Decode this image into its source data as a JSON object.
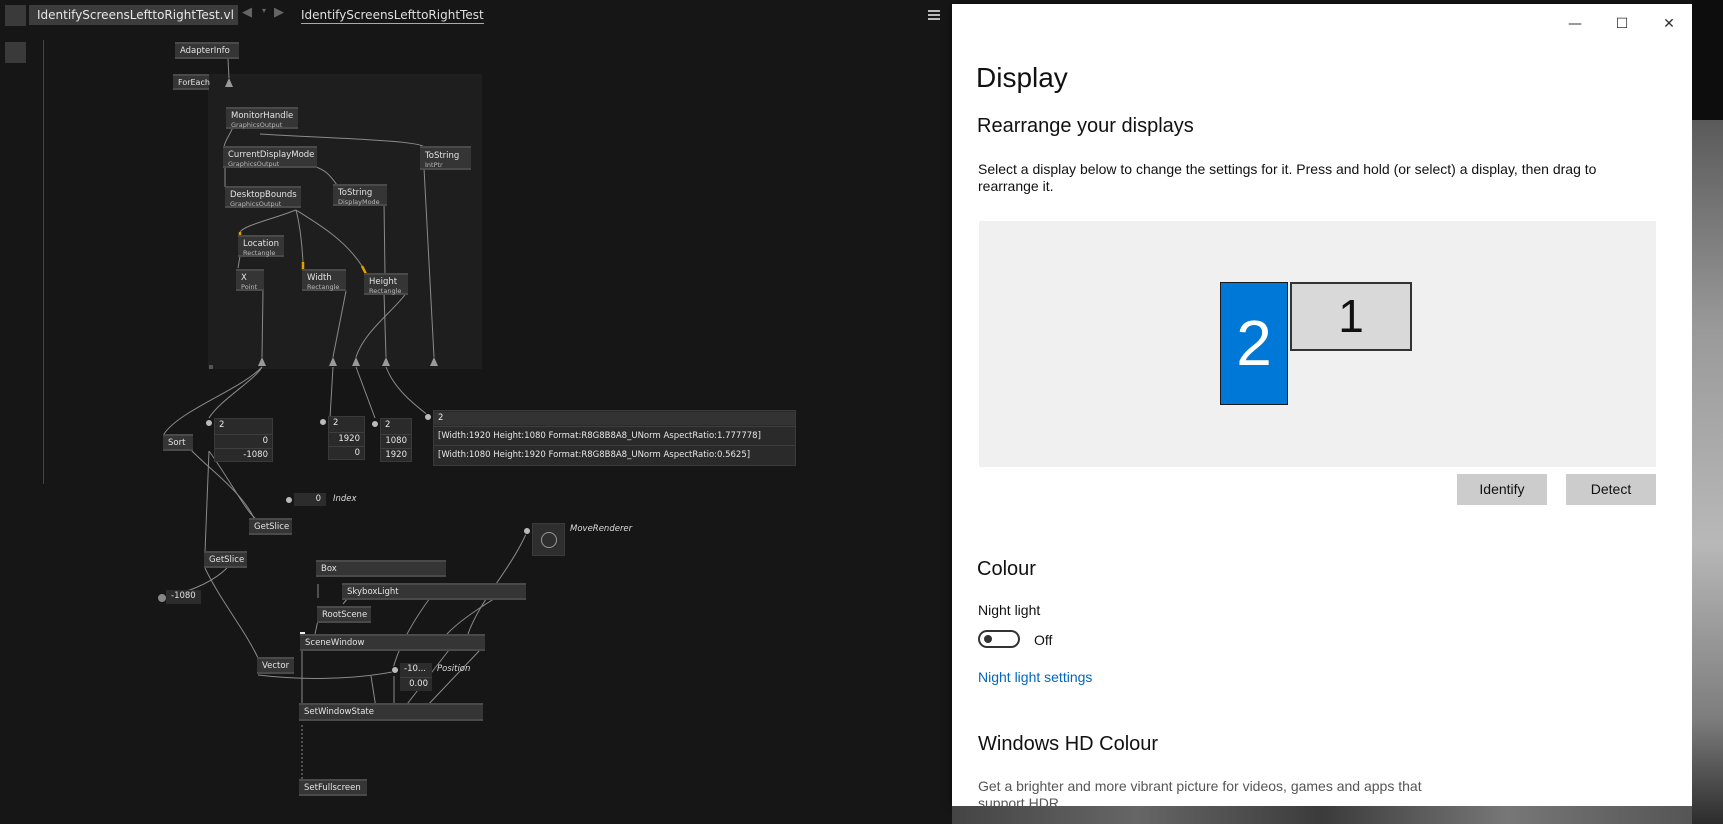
{
  "editor": {
    "document_tab": "IdentifyScreensLefttoRightTest.vl",
    "patch_title": "IdentifyScreensLefttoRightTest",
    "nodes": {
      "adapter_info": "AdapterInfo",
      "foreach": "ForEach",
      "monitor_handle": {
        "name": "MonitorHandle",
        "sub": "GraphicsOutput"
      },
      "current_display_mode": {
        "name": "CurrentDisplayMode",
        "sub": "GraphicsOutput"
      },
      "tostring_intptr": {
        "name": "ToString",
        "sub": "IntPtr"
      },
      "tostring_displaymode": {
        "name": "ToString",
        "sub": "DisplayMode"
      },
      "desktop_bounds": {
        "name": "DesktopBounds",
        "sub": "GraphicsOutput"
      },
      "location": {
        "name": "Location",
        "sub": "Rectangle"
      },
      "x": {
        "name": "X",
        "sub": "Point"
      },
      "width": {
        "name": "Width",
        "sub": "Rectangle"
      },
      "height": {
        "name": "Height",
        "sub": "Rectangle"
      },
      "sort": "Sort",
      "getslice_1": "GetSlice",
      "getslice_2": "GetSlice",
      "box": "Box",
      "skybox_light": "SkyboxLight",
      "root_scene": "RootScene",
      "scene_window": "SceneWindow",
      "vector": "Vector",
      "set_window_state": "SetWindowState",
      "set_fullscreen": "SetFullscreen"
    },
    "spreads": {
      "x_spread": {
        "count": "2",
        "values": [
          "0",
          "-1080"
        ]
      },
      "width_spread": {
        "count": "2",
        "values": [
          "1920",
          "0"
        ]
      },
      "height_spread": {
        "count": "2",
        "values": [
          "1080",
          "1920"
        ]
      },
      "modes_spread": {
        "count": "2",
        "values": [
          "[Width:1920 Height:1080 Format:R8G8B8A8_UNorm AspectRatio:1.777778]",
          "[Width:1080 Height:1920 Format:R8G8B8A8_UNorm AspectRatio:0.5625]"
        ]
      }
    },
    "index_value": "0",
    "index_label": "Index",
    "neg_value": "-1080",
    "move_renderer_label": "MoveRenderer",
    "position_values": [
      "-10...",
      "0.00"
    ],
    "position_label": "Position"
  },
  "settings": {
    "title": "Display",
    "section_rearrange": "Rearrange your displays",
    "instructions": "Select a display below to change the settings for it. Press and hold (or select) a display, then drag to rearrange it.",
    "monitor_selected": "2",
    "monitor_other": "1",
    "identify_button": "Identify",
    "detect_button": "Detect",
    "section_colour": "Colour",
    "night_light_label": "Night light",
    "night_light_state": "Off",
    "night_light_link": "Night light settings",
    "section_hdr": "Windows HD Colour",
    "hdr_text": "Get a brighter and more vibrant picture for videos, games and apps that support HDR.",
    "caption": {
      "minimize": "—",
      "maximize": "☐",
      "close": "✕"
    },
    "accent_color": "#0078d7",
    "link_color": "#0067c0"
  }
}
